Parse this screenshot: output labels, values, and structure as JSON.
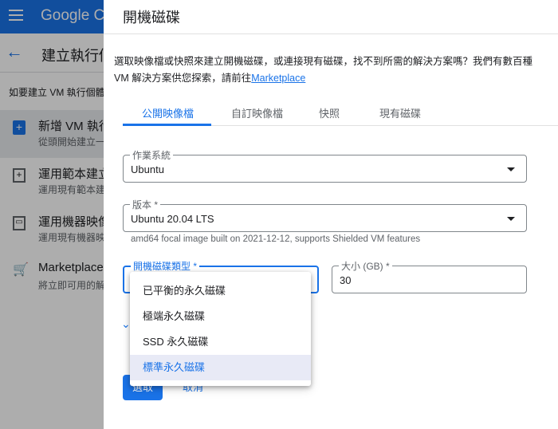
{
  "app": {
    "brand": "Google Cl",
    "page_title": "建立執行個",
    "intro": "如要建立 VM 執行個體"
  },
  "options": [
    {
      "title": "新增 VM 執行",
      "sub": "從頭開始建立一",
      "icon": "add-box-icon"
    },
    {
      "title": "運用範本建立",
      "sub": "運用現有範本建",
      "icon": "template-icon"
    },
    {
      "title": "運用機器映像",
      "sub": "運用現有機器映",
      "icon": "machine-image-icon"
    },
    {
      "title": "Marketplace",
      "sub": "將立即可用的解",
      "icon": "cart-icon"
    }
  ],
  "panel": {
    "title": "開機磁碟",
    "desc": "選取映像檔或快照來建立開機磁碟，或連接現有磁碟，找不到所需的解決方案嗎？我們有數百種 VM 解決方案供您探索，請前往",
    "link": "Marketplace",
    "tabs": [
      "公開映像檔",
      "自訂映像檔",
      "快照",
      "現有磁碟"
    ],
    "os": {
      "label": "作業系統",
      "value": "Ubuntu"
    },
    "version": {
      "label": "版本 *",
      "value": "Ubuntu 20.04 LTS",
      "hint": "amd64 focal image built on 2021-12-12, supports Shielded VM features"
    },
    "disk_type": {
      "label": "開機磁碟類型 *"
    },
    "size": {
      "label": "大小 (GB) *",
      "value": "30"
    },
    "dropdown": [
      "已平衡的永久磁碟",
      "極端永久磁碟",
      "SSD 永久磁碟",
      "標準永久磁碟"
    ],
    "select_label": "選取",
    "cancel_label": "取消"
  }
}
